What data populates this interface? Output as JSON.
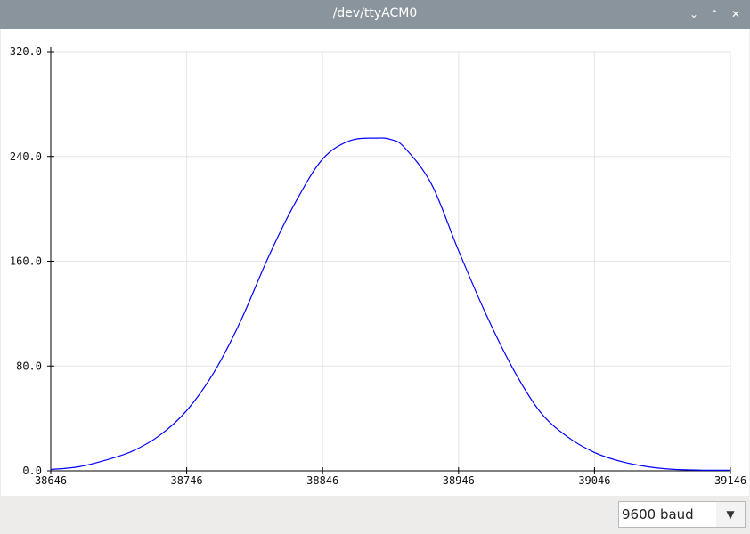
{
  "window": {
    "title": "/dev/ttyACM0",
    "buttons": {
      "minimize_icon": "chevron-down-icon",
      "maximize_icon": "chevron-up-icon",
      "close_icon": "close-icon"
    }
  },
  "baud": {
    "selected": "9600 baud",
    "arrow_icon": "triangle-down-icon"
  },
  "colors": {
    "titlebar": "#8a949c",
    "series": "#0000ff",
    "grid": "#e6e6e6",
    "axis": "#000000"
  },
  "chart_data": {
    "type": "line",
    "title": "",
    "xlabel": "",
    "ylabel": "",
    "xlim": [
      38646,
      39146
    ],
    "ylim": [
      0,
      320
    ],
    "x_ticks": [
      "38646",
      "38746",
      "38846",
      "38946",
      "39046",
      "39146"
    ],
    "y_ticks": [
      "0.0",
      "80.0",
      "160.0",
      "240.0",
      "320.0"
    ],
    "grid": true,
    "legend": "none",
    "series": [
      {
        "name": "",
        "x": [
          38646,
          38666,
          38686,
          38706,
          38726,
          38746,
          38766,
          38786,
          38806,
          38826,
          38846,
          38866,
          38886,
          38896,
          38906,
          38926,
          38946,
          38966,
          38986,
          39006,
          39026,
          39046,
          39066,
          39086,
          39106,
          39126,
          39132,
          39146
        ],
        "values": [
          1,
          3,
          8,
          15,
          27,
          46,
          75,
          115,
          163,
          205,
          238,
          252,
          254,
          253,
          247,
          219,
          168,
          120,
          78,
          45,
          26,
          14,
          7,
          3,
          1,
          0.5,
          0.5,
          0.5
        ]
      }
    ]
  }
}
